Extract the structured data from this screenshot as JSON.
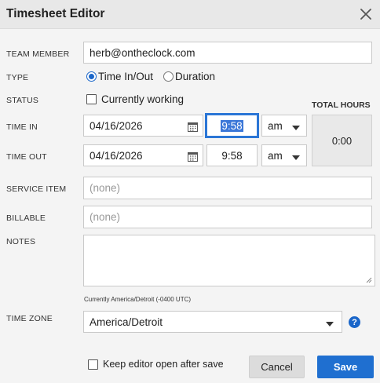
{
  "window": {
    "title": "Timesheet Editor"
  },
  "fields": {
    "team_member": {
      "label": "TEAM MEMBER",
      "value": "herb@ontheclock.com"
    },
    "type": {
      "label": "TYPE",
      "option1": "Time In/Out",
      "option2": "Duration",
      "selected": "Time In/Out"
    },
    "status": {
      "label": "STATUS",
      "checkbox_label": "Currently working",
      "checked": false
    },
    "time_in": {
      "label": "TIME IN",
      "date": "04/16/2026",
      "time": "9:58",
      "ampm": "am"
    },
    "time_out": {
      "label": "TIME OUT",
      "date": "04/16/2026",
      "time": "9:58",
      "ampm": "am"
    },
    "total_hours": {
      "label": "TOTAL HOURS",
      "value": "0:00"
    },
    "service_item": {
      "label": "SERVICE ITEM",
      "placeholder": "(none)"
    },
    "billable": {
      "label": "BILLABLE",
      "placeholder": "(none)"
    },
    "notes": {
      "label": "NOTES",
      "value": ""
    },
    "tz_note": "Currently America/Detroit (-0400 UTC)",
    "time_zone": {
      "label": "TIME ZONE",
      "value": "America/Detroit"
    }
  },
  "footer": {
    "keep_open_label": "Keep editor open after save",
    "cancel_label": "Cancel",
    "save_label": "Save"
  },
  "colors": {
    "accent": "#1f6fd0",
    "background": "#f4f4f4"
  },
  "icons": {
    "close": "close-icon",
    "calendar": "calendar-icon",
    "help": "help-icon",
    "dropdown": "chevron-down-icon"
  }
}
